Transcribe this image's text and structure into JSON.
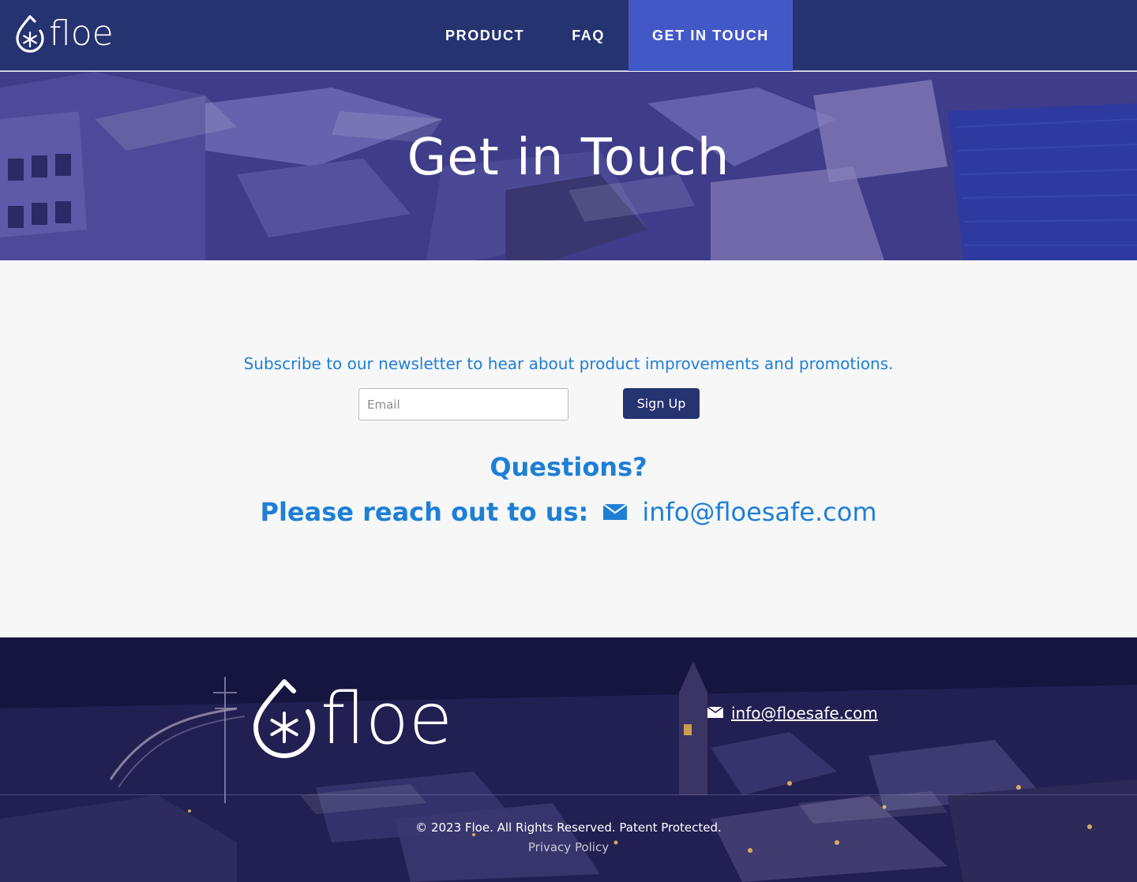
{
  "brand": {
    "name": "floe",
    "logo_icon": "drop-snowflake-icon"
  },
  "nav": {
    "items": [
      {
        "label": "PRODUCT",
        "active": false
      },
      {
        "label": "FAQ",
        "active": false
      },
      {
        "label": "GET IN TOUCH",
        "active": true
      }
    ]
  },
  "hero": {
    "title": "Get in Touch"
  },
  "newsletter": {
    "text": "Subscribe to our newsletter to hear about product improvements and promotions.",
    "email_placeholder": "Email",
    "button_label": "Sign Up"
  },
  "contact": {
    "questions": "Questions?",
    "reach_text": "Please reach out to us:",
    "email": "info@floesafe.com",
    "icon": "envelope-icon"
  },
  "footer": {
    "email": "info@floesafe.com",
    "copyright": "© 2023 Floe. All Rights Reserved. Patent Protected.",
    "privacy_label": "Privacy Policy"
  },
  "colors": {
    "nav_bg": "#263371",
    "nav_active": "#4358c7",
    "accent_blue": "#1e7fd6",
    "button_bg": "#263371",
    "page_bg": "#f7f7f8"
  }
}
